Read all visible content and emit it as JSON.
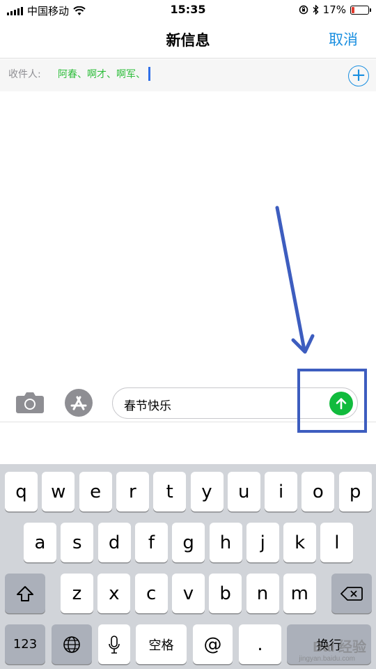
{
  "status_bar": {
    "carrier": "中国移动",
    "time": "15:35",
    "battery": "17%",
    "battery_level": 0.17,
    "battery_color": "#e23b2e"
  },
  "nav": {
    "title": "新信息",
    "cancel": "取消"
  },
  "recipients": {
    "label": "收件人:",
    "names": "阿春、啊才、啊军、",
    "add_icon": "plus-circle-icon"
  },
  "compose": {
    "message": "春节快乐",
    "camera_icon": "camera-icon",
    "appstore_icon": "app-store-icon",
    "send_icon": "send-arrow-up-icon"
  },
  "keyboard": {
    "row1": [
      "q",
      "w",
      "e",
      "r",
      "t",
      "y",
      "u",
      "i",
      "o",
      "p"
    ],
    "row2": [
      "a",
      "s",
      "d",
      "f",
      "g",
      "h",
      "j",
      "k",
      "l"
    ],
    "row3": [
      "z",
      "x",
      "c",
      "v",
      "b",
      "n",
      "m"
    ],
    "shift_icon": "shift-icon",
    "delete_icon": "delete-icon",
    "numbers": "123",
    "globe_icon": "globe-icon",
    "mic_icon": "microphone-icon",
    "space": "空格",
    "at": "@",
    "period": ".",
    "return": "换行"
  },
  "watermark": {
    "main": "Bai 经验",
    "sub": "jingyan.baidu.com"
  },
  "colors": {
    "accent": "#1a8fe0",
    "recipient": "#2dbd3a",
    "send": "#11bb3d",
    "annotation": "#3d5dbf"
  }
}
